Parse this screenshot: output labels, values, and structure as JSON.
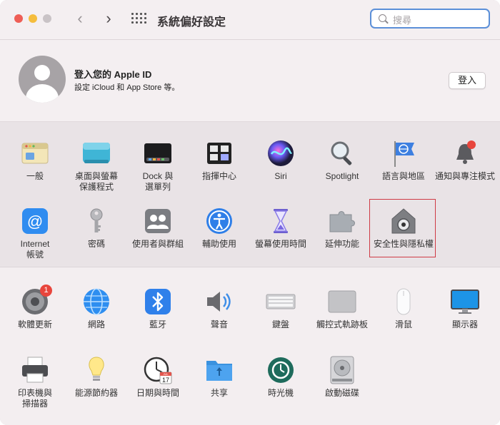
{
  "window": {
    "title": "系統偏好設定"
  },
  "search": {
    "placeholder": "搜尋"
  },
  "apple_id": {
    "title": "登入您的 Apple ID",
    "subtitle": "設定 iCloud 和 App Store 等。",
    "button": "登入"
  },
  "section1": {
    "row1": [
      {
        "label": "一般",
        "icon": "general-icon"
      },
      {
        "label": "桌面與螢幕\n保護程式",
        "icon": "desktop-screensaver-icon"
      },
      {
        "label": "Dock 與\n選單列",
        "icon": "dock-icon"
      },
      {
        "label": "指揮中心",
        "icon": "mission-control-icon"
      },
      {
        "label": "Siri",
        "icon": "siri-icon"
      },
      {
        "label": "Spotlight",
        "icon": "spotlight-icon"
      },
      {
        "label": "語言與地區",
        "icon": "language-region-icon"
      },
      {
        "label": "通知與專注模式",
        "icon": "notifications-icon"
      }
    ],
    "row2": [
      {
        "label": "Internet\n帳號",
        "icon": "internet-accounts-icon"
      },
      {
        "label": "密碼",
        "icon": "key-icon"
      },
      {
        "label": "使用者與群組",
        "icon": "users-groups-icon"
      },
      {
        "label": "輔助使用",
        "icon": "accessibility-icon"
      },
      {
        "label": "螢幕使用時間",
        "icon": "screen-time-icon"
      },
      {
        "label": "延伸功能",
        "icon": "extensions-icon"
      },
      {
        "label": "安全性與隱私權",
        "icon": "security-privacy-icon"
      }
    ]
  },
  "section2": {
    "row1": [
      {
        "label": "軟體更新",
        "icon": "software-update-icon",
        "badge": "1"
      },
      {
        "label": "網路",
        "icon": "network-icon"
      },
      {
        "label": "藍牙",
        "icon": "bluetooth-icon"
      },
      {
        "label": "聲音",
        "icon": "sound-icon"
      },
      {
        "label": "鍵盤",
        "icon": "keyboard-icon"
      },
      {
        "label": "觸控式軌跡板",
        "icon": "trackpad-icon"
      },
      {
        "label": "滑鼠",
        "icon": "mouse-icon"
      },
      {
        "label": "顯示器",
        "icon": "displays-icon"
      }
    ],
    "row2": [
      {
        "label": "印表機與\n掃描器",
        "icon": "printers-scanners-icon"
      },
      {
        "label": "能源節約器",
        "icon": "energy-saver-icon"
      },
      {
        "label": "日期與時間",
        "icon": "date-time-icon"
      },
      {
        "label": "共享",
        "icon": "sharing-icon"
      },
      {
        "label": "時光機",
        "icon": "time-machine-icon"
      },
      {
        "label": "啟動磁碟",
        "icon": "startup-disk-icon"
      }
    ]
  },
  "date_icon": {
    "month": "JUL",
    "day": "17"
  },
  "colors": {
    "accent": "#5b8fd8",
    "selection": "#cf3a45"
  }
}
